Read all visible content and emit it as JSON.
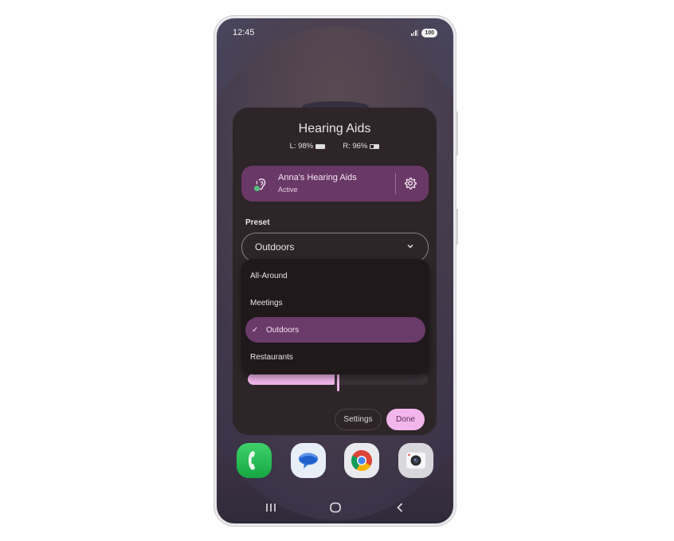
{
  "status_bar": {
    "time": "12:45",
    "battery": "100",
    "icons": [
      "signal-icon",
      "battery-icon"
    ]
  },
  "dialog": {
    "title": "Hearing Aids",
    "left_battery": "L: 98%",
    "right_battery": "R: 96%",
    "device": {
      "name": "Anna's Hearing Aids",
      "status": "Active",
      "status_color": "#52c27a",
      "card_color": "#6a3866"
    },
    "preset": {
      "label": "Preset",
      "value": "Outdoors",
      "options": [
        {
          "label": "All-Around",
          "selected": false
        },
        {
          "label": "Meetings",
          "selected": false
        },
        {
          "label": "Outdoors",
          "selected": true
        },
        {
          "label": "Restaurants",
          "selected": false
        }
      ]
    },
    "slider": {
      "value_fraction": 0.5
    },
    "buttons": {
      "settings": "Settings",
      "done": "Done"
    },
    "accent_color": "#f2b6ec"
  },
  "dock": {
    "apps": [
      {
        "name": "Phone"
      },
      {
        "name": "Messages"
      },
      {
        "name": "Chrome"
      },
      {
        "name": "Camera"
      }
    ]
  },
  "nav_bar": {
    "buttons": [
      "recents",
      "home",
      "back"
    ]
  }
}
